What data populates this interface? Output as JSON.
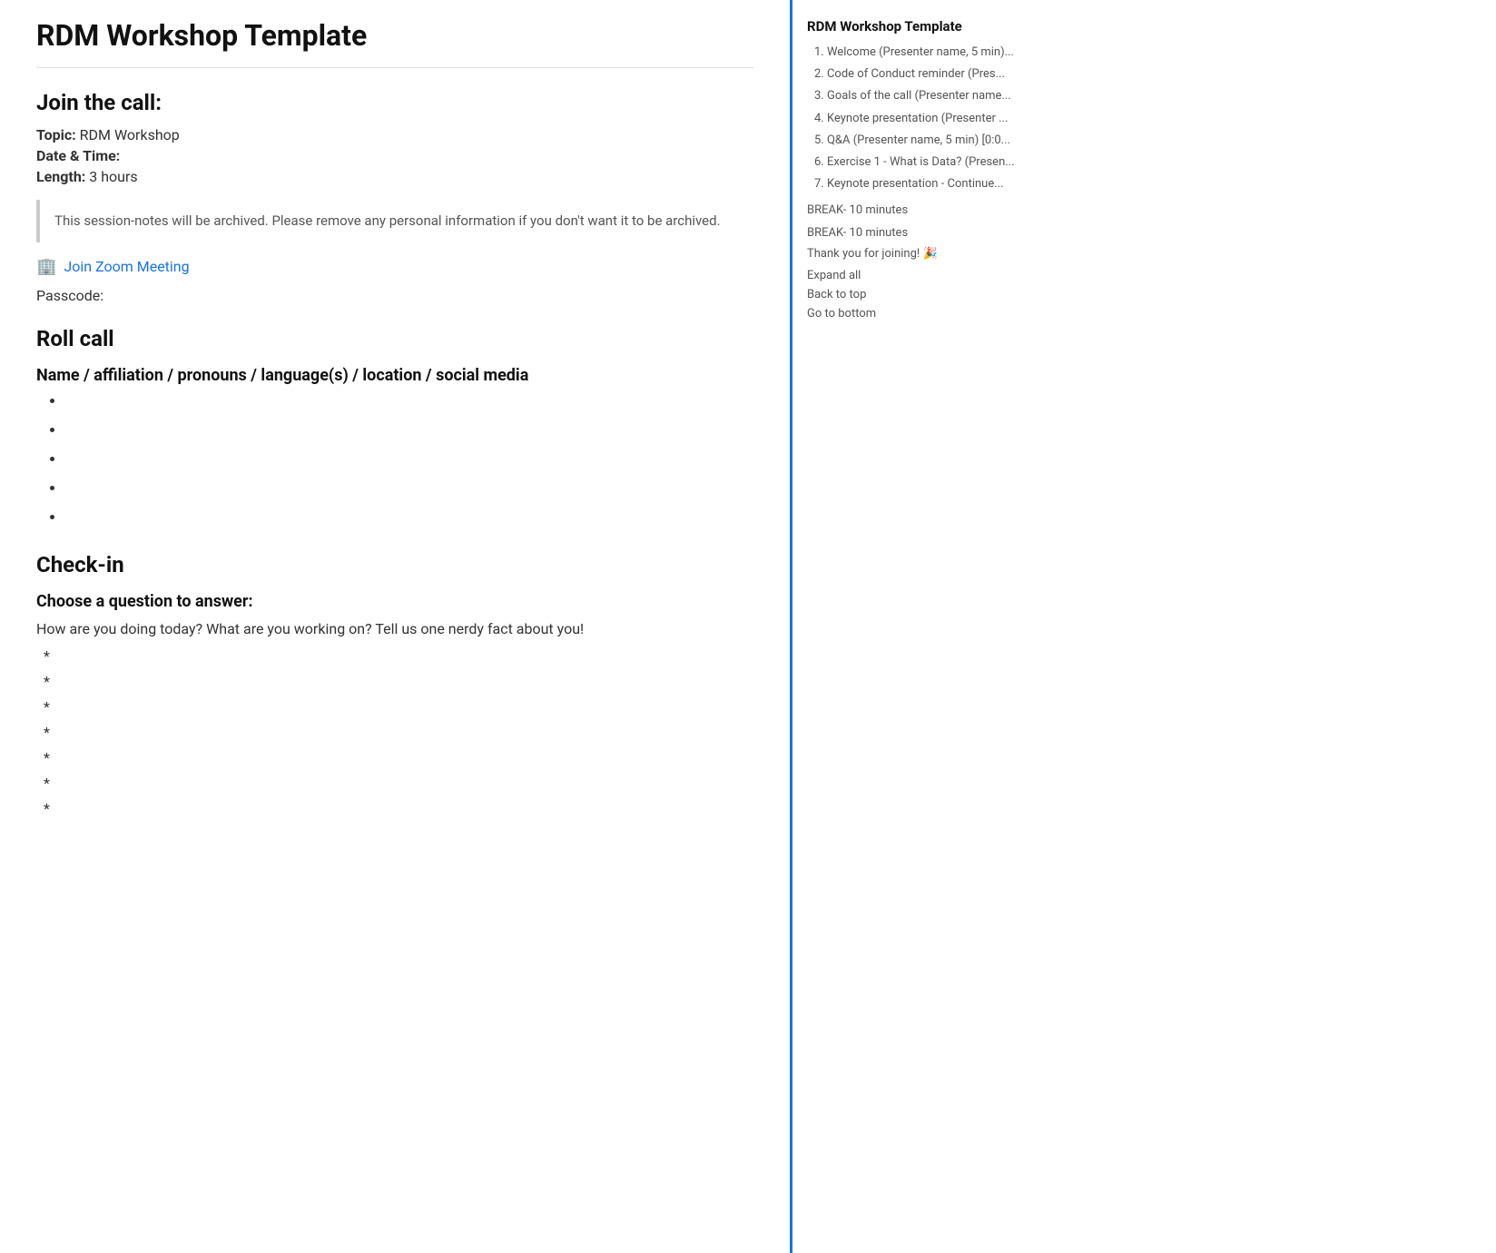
{
  "page": {
    "title": "RDM Workshop Template"
  },
  "main": {
    "title": "RDM Workshop Template",
    "join_section": {
      "heading": "Join the call:",
      "topic_label": "Topic:",
      "topic_value": "RDM Workshop",
      "date_label": "Date & Time:",
      "length_label": "Length:",
      "length_value": "3 hours"
    },
    "blockquote": "This session-notes will be archived. Please remove any personal information if you don't want it to be archived.",
    "zoom_icon": "🏢",
    "zoom_link_text": "Join Zoom Meeting",
    "passcode_label": "Passcode:",
    "roll_call": {
      "heading": "Roll call",
      "subheading": "Name / affiliation / pronouns / language(s) / location / social media",
      "items": [
        "",
        "",
        "",
        "",
        ""
      ]
    },
    "checkin": {
      "heading": "Check-in",
      "subheading": "Choose a question to answer:",
      "question": "How are you doing today? What are you working on? Tell us one nerdy fact about you!",
      "items": [
        "",
        "",
        "",
        "",
        "",
        "",
        ""
      ]
    }
  },
  "sidebar": {
    "title": "RDM Workshop Template",
    "toc_items": [
      {
        "number": "1.",
        "text": "Welcome (Presenter name, 5 min)..."
      },
      {
        "number": "2.",
        "text": "Code of Conduct reminder  (Pres..."
      },
      {
        "number": "3.",
        "text": "Goals of the call (Presenter name..."
      },
      {
        "number": "4.",
        "text": "Keynote presentation (Presenter ..."
      },
      {
        "number": "5.",
        "text": "Q&A (Presenter name, 5 min) [0:0..."
      },
      {
        "number": "6.",
        "text": "Exercise 1 - What is Data? (Presen..."
      },
      {
        "number": "7.",
        "text": "Keynote presentation - Continue..."
      }
    ],
    "break1": "BREAK- 10 minutes",
    "break2": "BREAK- 10 minutes",
    "thank_you": "Thank you for joining! 🎉",
    "expand_all": "Expand all",
    "back_to_top": "Back to top",
    "go_to_bottom": "Go to bottom"
  }
}
